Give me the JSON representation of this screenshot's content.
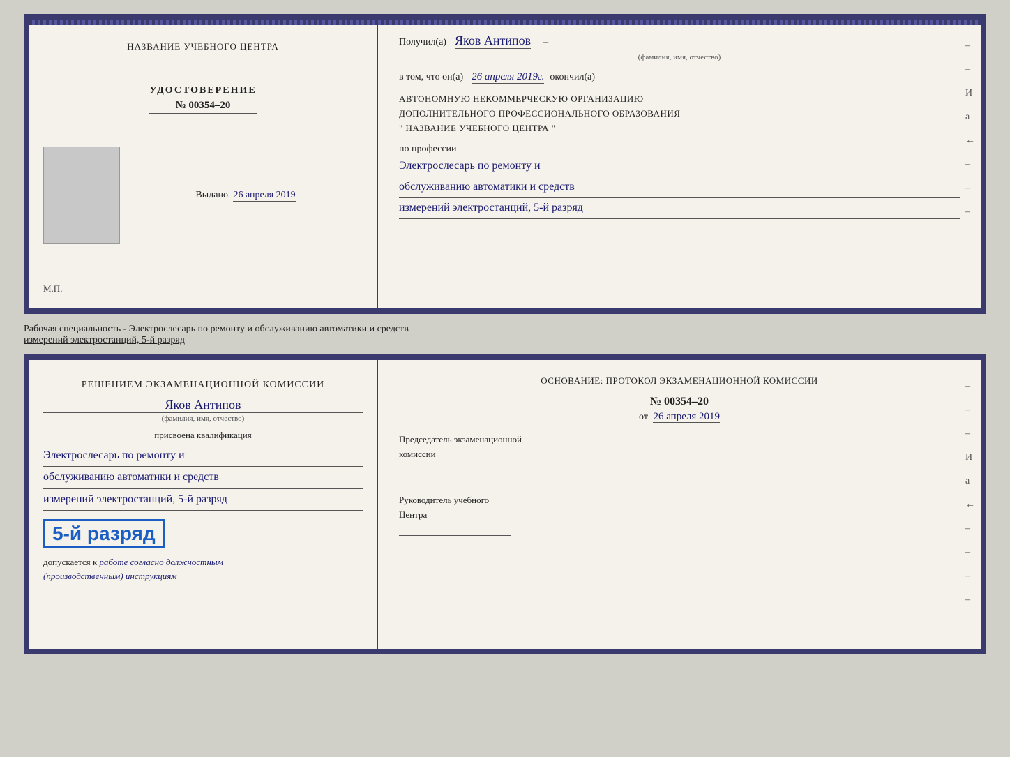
{
  "top_doc": {
    "left": {
      "center_title": "НАЗВАНИЕ УЧЕБНОГО ЦЕНТРА",
      "udostoverenie": "УДОСТОВЕРЕНИЕ",
      "number": "№ 00354–20",
      "vydano_label": "Выдано",
      "vydano_date": "26 апреля 2019",
      "mp": "М.П."
    },
    "right": {
      "poluchil_label": "Получил(а)",
      "fio": "Яков Антипов",
      "fio_sub": "(фамилия, имя, отчество)",
      "vtom_label": "в том, что он(а)",
      "date_hand": "26 апреля 2019г.",
      "okonchil": "окончил(а)",
      "org_line1": "АВТОНОМНУЮ НЕКОММЕРЧЕСКУЮ ОРГАНИЗАЦИЮ",
      "org_line2": "ДОПОЛНИТЕЛЬНОГО ПРОФЕССИОНАЛЬНОГО ОБРАЗОВАНИЯ",
      "org_line3": "\"  НАЗВАНИЕ УЧЕБНОГО ЦЕНТРА  \"",
      "po_professii": "по профессии",
      "prof1": "Электрослесарь по ремонту и",
      "prof2": "обслуживанию автоматики и средств",
      "prof3": "измерений электростанций, 5-й разряд"
    }
  },
  "middle_text": {
    "line1": "Рабочая специальность - Электрослесарь по ремонту и обслуживанию автоматики и средств",
    "line2": "измерений электростанций, 5-й разряд"
  },
  "bottom_doc": {
    "left": {
      "komissia": "Решением экзаменационной комиссии",
      "fio": "Яков Антипов",
      "fio_sub": "(фамилия, имя, отчество)",
      "prisvoena": "присвоена квалификация",
      "kval1": "Электрослесарь по ремонту и",
      "kval2": "обслуживанию автоматики и средств",
      "kval3": "измерений электростанций, 5-й разряд",
      "razryad_badge": "5-й разряд",
      "dopuskaetsya": "допускается к",
      "dopuskaetsya_hand": "работе согласно должностным",
      "instruktsiyam": "(производственным) инструкциям"
    },
    "right": {
      "osnovanie": "Основание: протокол экзаменационной комиссии",
      "number": "№  00354–20",
      "ot_label": "от",
      "ot_date": "26 апреля 2019",
      "predsedatel_line1": "Председатель экзаменационной",
      "predsedatel_line2": "комиссии",
      "rukovoditel_line1": "Руководитель учебного",
      "rukovoditel_line2": "Центра"
    }
  }
}
